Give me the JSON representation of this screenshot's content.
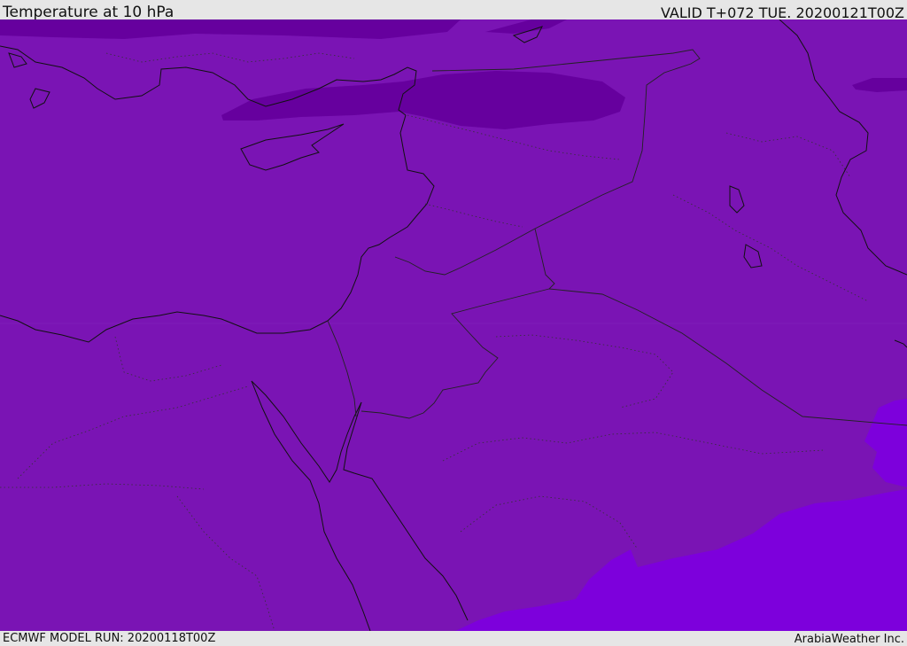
{
  "header": {
    "title": "Temperature at 10 hPa",
    "valid_time": "VALID T+072 TUE. 20200121T00Z"
  },
  "footer": {
    "model_run": "ECMWF MODEL RUN: 20200118T00Z",
    "credit": "ArabiaWeather Inc."
  },
  "map": {
    "colors": {
      "base_fill": "#7a14b4",
      "cold_patch": "#66009e",
      "warm_patch": "#7d00dc",
      "coastline": "#111111",
      "border": "#222222"
    }
  }
}
